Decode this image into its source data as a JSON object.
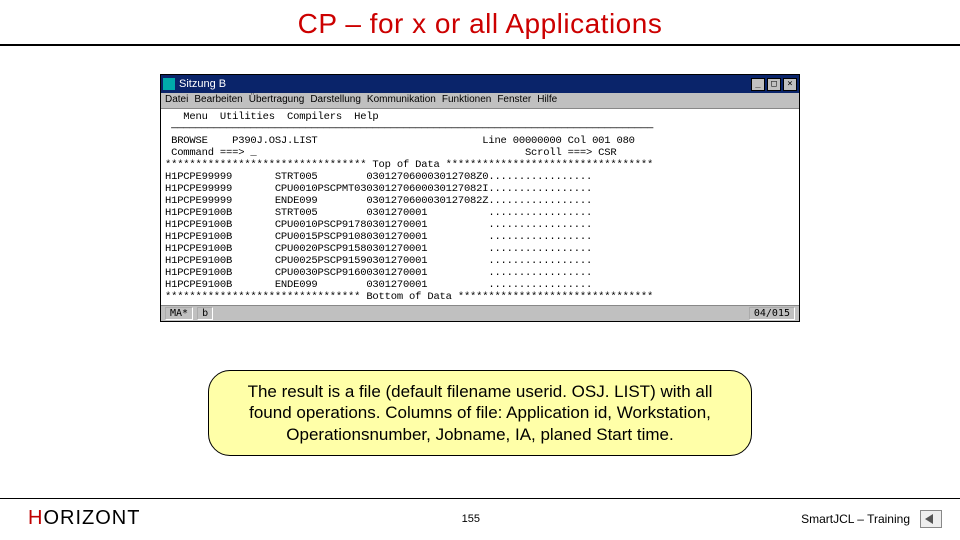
{
  "title": "CP – for x or all Applications",
  "window": {
    "title": "Sitzung B",
    "menu": [
      "Datei",
      "Bearbeiten",
      "Übertragung",
      "Darstellung",
      "Kommunikation",
      "Funktionen",
      "Fenster",
      "Hilfe"
    ]
  },
  "terminal": {
    "lines": [
      "   Menu  Utilities  Compilers  Help                                             ",
      " ───────────────────────────────────────────────────────────────────────────────",
      " BROWSE    P390J.OSJ.LIST                           Line 00000000 Col 001 080  ",
      " Command ===> _                                            Scroll ===> CSR     ",
      "********************************* Top of Data **********************************",
      "H1PCPE99999       STRT005        030127060003012708Z0.................         ",
      "H1PCPE99999       CPU0010PSCPMT030301270600030127082I.................         ",
      "H1PCPE99999       ENDE099        0301270600030127082Z.................         ",
      "H1PCPE9100B       STRT005        0301270001          .................         ",
      "H1PCPE9100B       CPU0010PSCP91780301270001          .................         ",
      "H1PCPE9100B       CPU0015PSCP91080301270001          .................         ",
      "H1PCPE9100B       CPU0020PSCP91580301270001          .................         ",
      "H1PCPE9100B       CPU0025PSCP91590301270001          .................         ",
      "H1PCPE9100B       CPU0030PSCP91600301270001          .................         ",
      "H1PCPE9100B       ENDE099        0301270001          .................         ",
      "******************************** Bottom of Data ********************************"
    ]
  },
  "status": {
    "left1": "MA*",
    "left2": "b",
    "right": "04/015"
  },
  "callout": "The result is a file (default filename userid. OSJ. LIST) with all found operations. Columns of file: Application id, Workstation, Operationsnumber, Jobname, IA, planed Start time.",
  "footer": {
    "brand_h": "H",
    "brand_rest": "ORIZONT",
    "page": "155",
    "right": "SmartJCL – Training"
  }
}
